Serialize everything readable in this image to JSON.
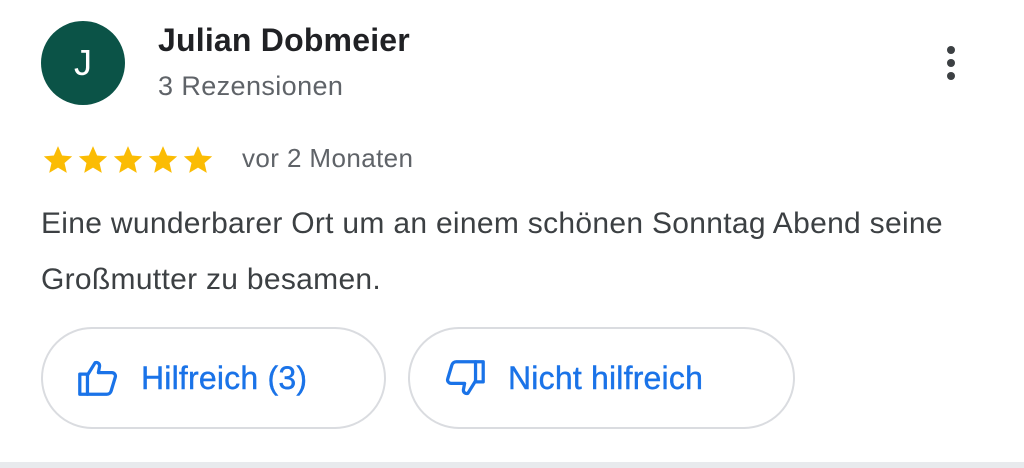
{
  "review": {
    "author": {
      "initial": "J",
      "name": "Julian Dobmeier",
      "review_count": "3 Rezensionen",
      "avatar_color": "#0b5347"
    },
    "more_options_icon": "more-vert-icon",
    "rating": {
      "stars": 5,
      "max_stars": 5,
      "star_color": "#fbbc04"
    },
    "time": "vor 2 Monaten",
    "text": "Eine wunderbarer Ort um an einem schönen Sonntag Abend seine Großmutter zu besamen.",
    "actions": {
      "helpful_label": "Hilfreich (3)",
      "helpful_icon": "thumb-up-icon",
      "not_helpful_label": "Nicht hilfreich",
      "not_helpful_icon": "thumb-down-icon",
      "accent_color": "#1a73e8"
    }
  }
}
